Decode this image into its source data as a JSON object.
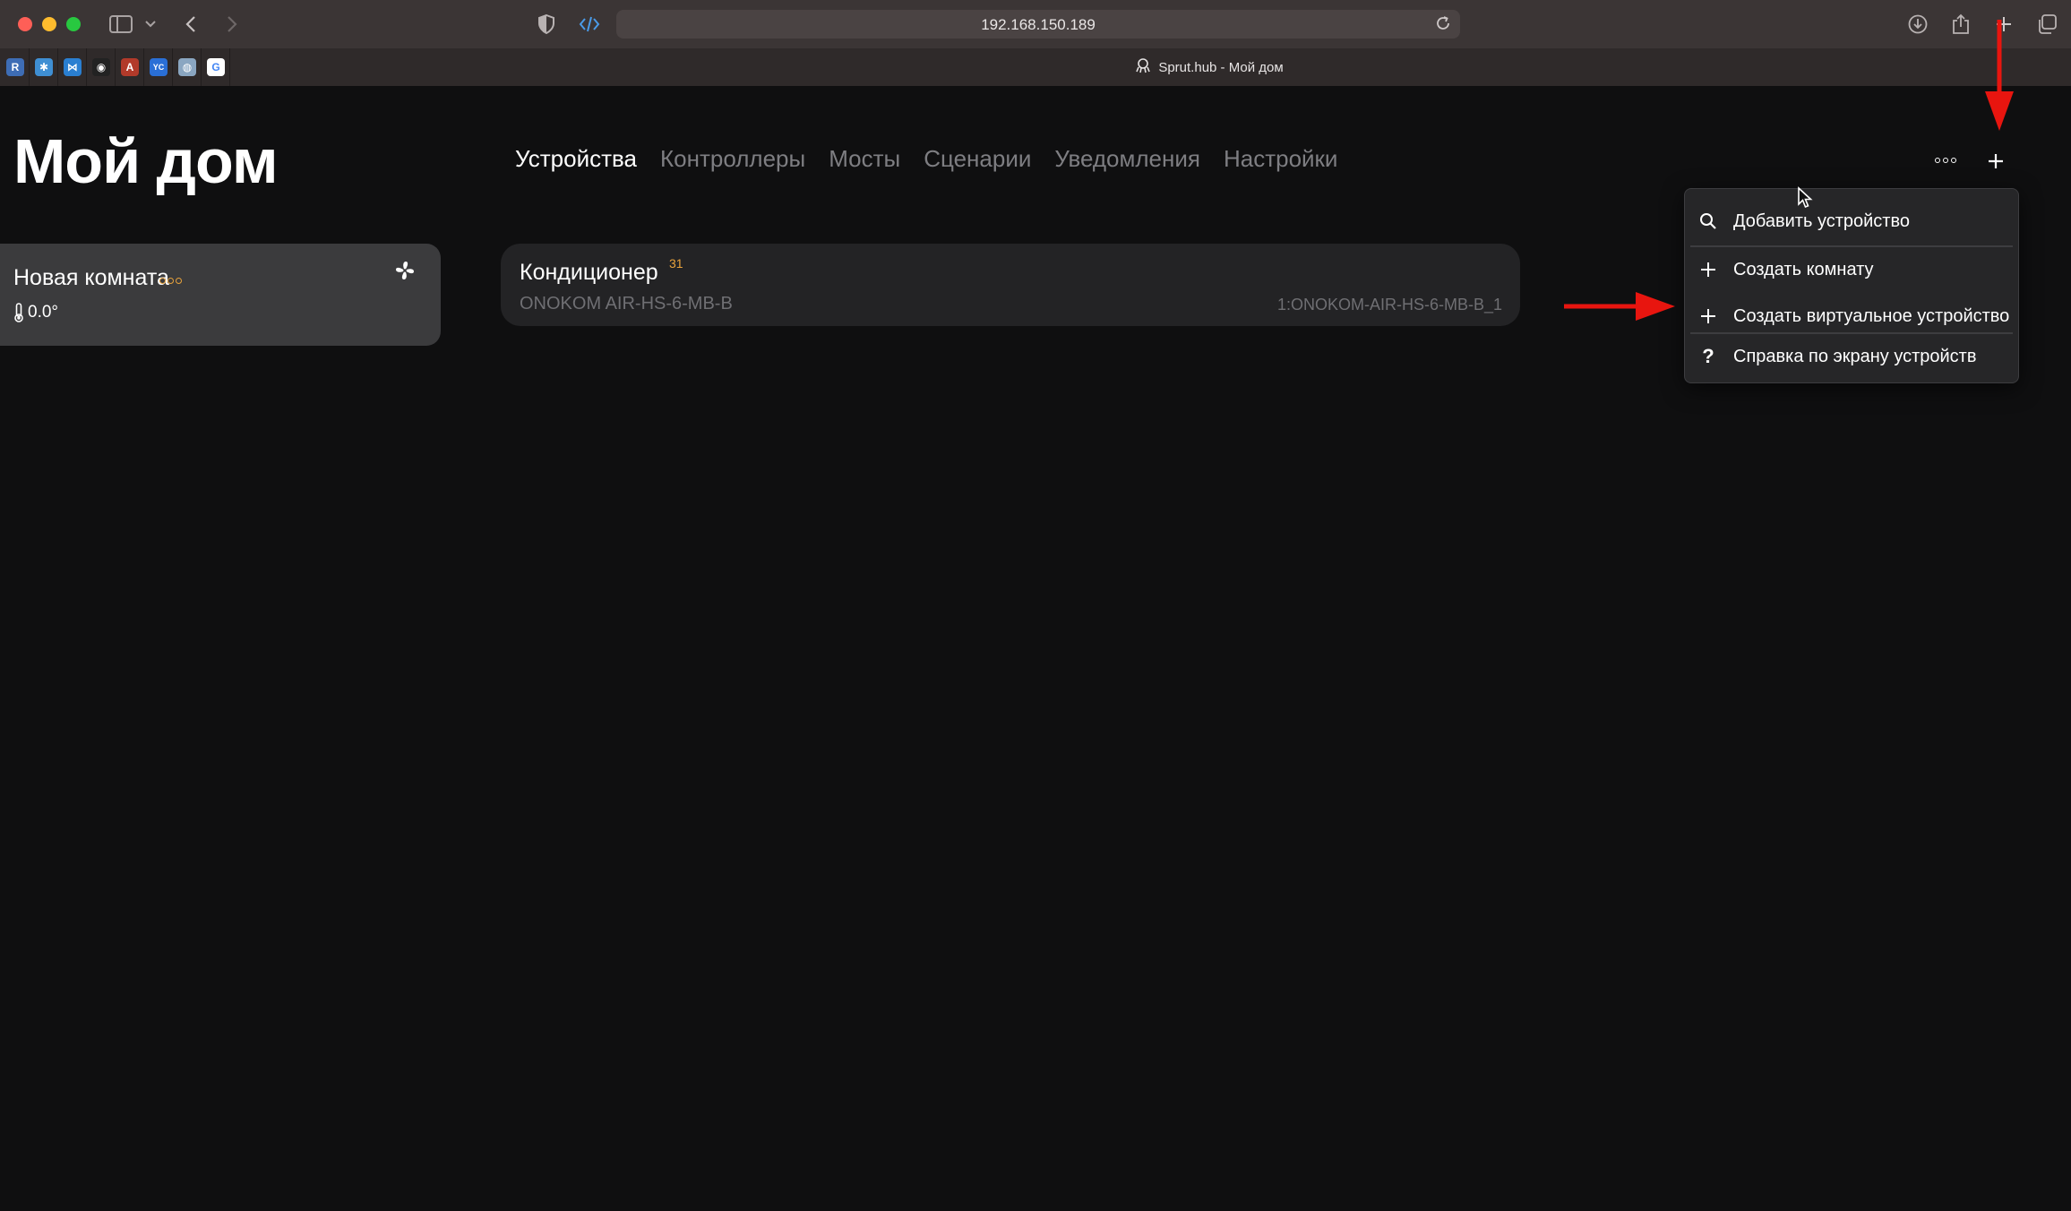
{
  "browser": {
    "url": "192.168.150.189",
    "tab_title": "Sprut.hub - Мой дом",
    "pinned_tabs": [
      {
        "icon": "r-square-icon",
        "glyph": "R",
        "color": "#3e6db5"
      },
      {
        "icon": "snowflake-app-icon",
        "glyph": "✱",
        "color": "#3f8fd3"
      },
      {
        "icon": "vscode-icon",
        "glyph": "⋈",
        "color": "#2a7fd1"
      },
      {
        "icon": "github-icon",
        "glyph": "◉",
        "color": "#222222"
      },
      {
        "icon": "ax-app-icon",
        "glyph": "A",
        "color": "#b23a2a"
      },
      {
        "icon": "yc-icon",
        "glyph": "YC",
        "color": "#2a6fd6"
      },
      {
        "icon": "globe-app-icon",
        "glyph": "◍",
        "color": "#8aa6c1"
      },
      {
        "icon": "google-icon",
        "glyph": "G",
        "color": "#ffffff"
      }
    ]
  },
  "page": {
    "title": "Мой дом"
  },
  "nav": {
    "tabs": [
      {
        "label": "Устройства",
        "active": true
      },
      {
        "label": "Контроллеры",
        "active": false
      },
      {
        "label": "Мосты",
        "active": false
      },
      {
        "label": "Сценарии",
        "active": false
      },
      {
        "label": "Уведомления",
        "active": false
      },
      {
        "label": "Настройки",
        "active": false
      }
    ]
  },
  "room": {
    "name": "Новая комната",
    "temperature": "0.0°"
  },
  "device": {
    "name": "Кондиционер",
    "badge": "31",
    "model": "ONOKOM AIR-HS-6-MB-B",
    "id": "1:ONOKOM-AIR-HS-6-MB-B_1"
  },
  "menu": {
    "items": [
      {
        "label": "Добавить устройство",
        "icon": "search-icon"
      },
      {
        "label": "Создать комнату",
        "icon": "plus-icon"
      },
      {
        "label": "Создать виртуальное устройство",
        "icon": "plus-icon"
      },
      {
        "label": "Справка по экрану устройств",
        "icon": "question-icon"
      }
    ]
  },
  "colors": {
    "accent_orange": "#e8a23c",
    "annotation_red": "#e8150f",
    "background": "#0f0f10"
  }
}
